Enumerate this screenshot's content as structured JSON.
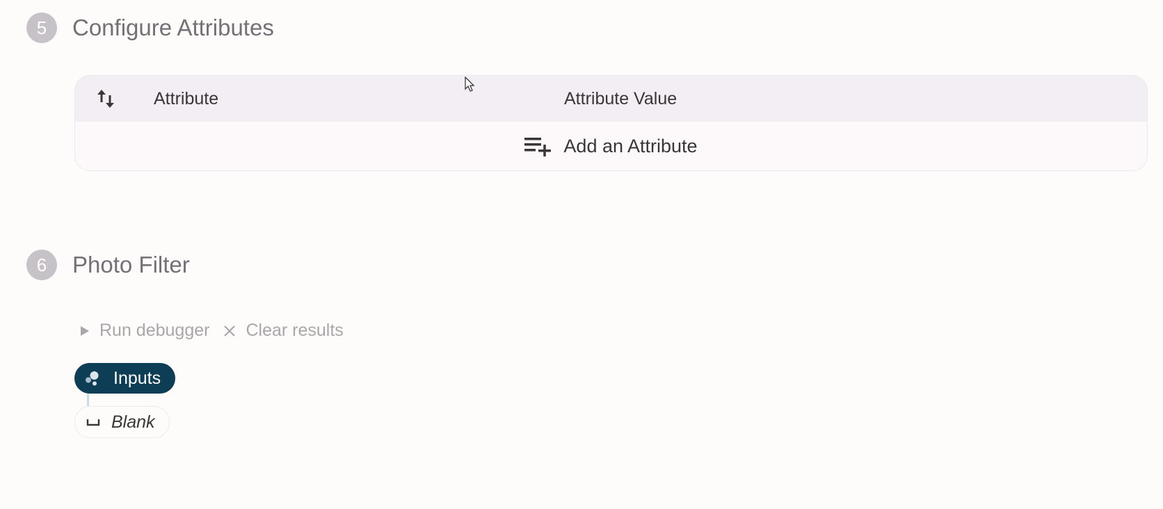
{
  "sections": {
    "configure": {
      "step_number": "5",
      "title": "Configure Attributes",
      "table": {
        "columns": [
          "Attribute",
          "Attribute Value"
        ],
        "add_label": "Add an Attribute"
      }
    },
    "photo_filter": {
      "step_number": "6",
      "title": "Photo Filter",
      "toolbar": {
        "run_label": "Run debugger",
        "clear_label": "Clear results"
      },
      "nodes": {
        "inputs_label": "Inputs",
        "blank_label": "Blank"
      }
    }
  },
  "icons": {
    "sort": "swap-vertical-icon",
    "add": "playlist-add-icon",
    "run": "play-icon",
    "clear": "close-icon",
    "inputs": "bubbles-icon",
    "blank": "space-bar-icon",
    "cursor": "mouse-pointer-icon"
  },
  "colors": {
    "background": "#fdfcfb",
    "step_circle": "#c6c2c7",
    "step_title": "#757075",
    "table_header": "#f2eef4",
    "inputs_pill": "#0e3d56",
    "toolbar_text": "#aaa6aa",
    "connector": "#c9dbe6"
  }
}
